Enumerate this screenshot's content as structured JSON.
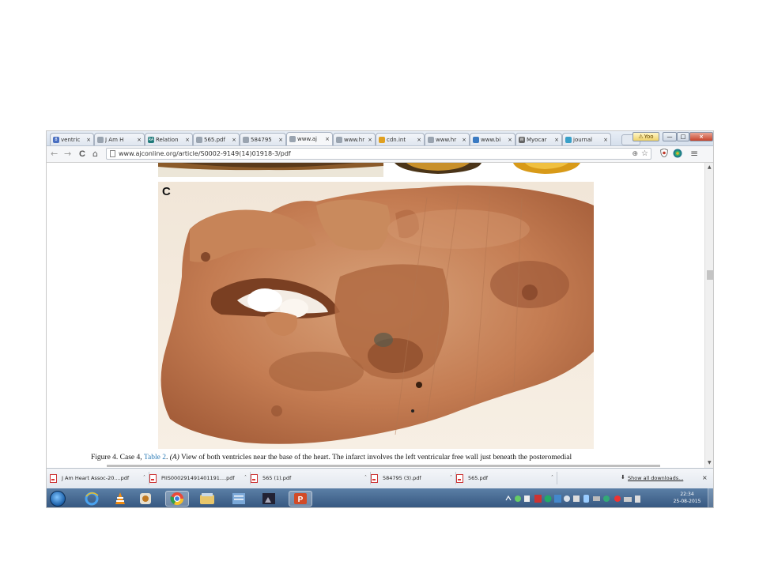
{
  "browser": {
    "tabs": [
      {
        "label": "ventric",
        "favicon_color": "#4a6fc1",
        "favicon_text": "8"
      },
      {
        "label": "J Am H",
        "favicon_color": "#9aa4b0",
        "favicon_text": ""
      },
      {
        "label": "Relation",
        "favicon_color": "#1f7a7a",
        "favicon_text": "RA"
      },
      {
        "label": "565.pdf",
        "favicon_color": "#9aa4b0",
        "favicon_text": ""
      },
      {
        "label": "584795",
        "favicon_color": "#9aa4b0",
        "favicon_text": ""
      },
      {
        "label": "www.aj",
        "favicon_color": "#9aa4b0",
        "favicon_text": "",
        "active": true
      },
      {
        "label": "www.hr",
        "favicon_color": "#9aa4b0",
        "favicon_text": ""
      },
      {
        "label": "cdn.int",
        "favicon_color": "#e0a020",
        "favicon_text": ""
      },
      {
        "label": "www.hr",
        "favicon_color": "#9aa4b0",
        "favicon_text": ""
      },
      {
        "label": "www.bi",
        "favicon_color": "#3a7ac2",
        "favicon_text": ""
      },
      {
        "label": "Myocar",
        "favicon_color": "#666666",
        "favicon_text": "W"
      },
      {
        "label": "journal",
        "favicon_color": "#3aa0c8",
        "favicon_text": ""
      }
    ],
    "close_glyph": "×",
    "window_buttons": {
      "alert": "Yoo",
      "minimize": "—",
      "maximize": "□",
      "close": "×"
    },
    "nav": {
      "back": "←",
      "forward": "→",
      "reload": "C",
      "home": "⌂"
    },
    "url": "www.ajconline.org/article/S0002-9149(14)01918-3/pdf",
    "toolbar_right": {
      "zoom": "⊕",
      "star": "☆",
      "menu": "≡"
    }
  },
  "document": {
    "panel_letter": "C",
    "caption": {
      "prefix": "Figure 4. Case 4, ",
      "link": "Table 2",
      "sep": ". ",
      "panel_ref": "(A)",
      "text": " View of both ventricles near the base of the heart. The infarct involves the left ventricular free wall just beneath the posteromedial"
    }
  },
  "downloads": {
    "items": [
      {
        "name": "J Am Heart Assoc-20....pdf"
      },
      {
        "name": "PIIS000291491401191....pdf"
      },
      {
        "name": "565 (1).pdf"
      },
      {
        "name": "584795 (3).pdf"
      },
      {
        "name": "565.pdf"
      }
    ],
    "caret": "˄",
    "show_all": "Show all downloads...",
    "download_glyph": "⬇",
    "close": "×"
  },
  "taskbar": {
    "clock_time": "22:34",
    "clock_date": "25-08-2015",
    "apps": [
      "ie-icon",
      "vlc-icon",
      "media-player-icon",
      "chrome-icon",
      "explorer-icon",
      "notes-icon",
      "photo-viewer-icon",
      "powerpoint-icon"
    ]
  }
}
